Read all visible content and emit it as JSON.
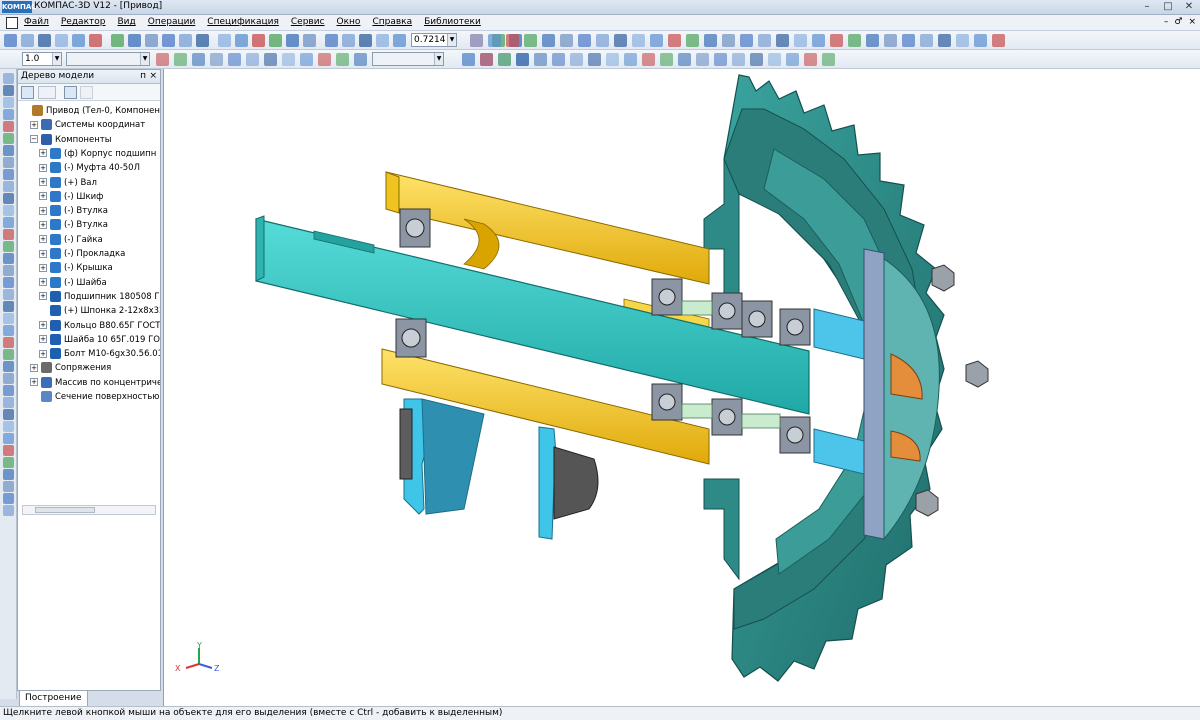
{
  "window": {
    "logo": "KOMПАС",
    "title": "КОМПАС-3D V12 - [Привод]",
    "controls": [
      "–",
      "□",
      "✕"
    ]
  },
  "menu": {
    "app_icon": "document-icon",
    "items": [
      "Файл",
      "Редактор",
      "Вид",
      "Операции",
      "Спецификация",
      "Сервис",
      "Окно",
      "Справка",
      "Библиотеки"
    ],
    "mdi_controls": [
      "–",
      "♂",
      "×"
    ]
  },
  "toolbar": {
    "zoom_value": "0.7214",
    "step_value": "1.0"
  },
  "tree": {
    "title": "Дерево модели",
    "pin": "п",
    "close": "×",
    "tab_label": "Построение",
    "items": [
      {
        "label": "Привод (Тел-0, Компонентов",
        "icon": "assembly-icon",
        "indent": 0,
        "expander": ""
      },
      {
        "label": "Системы координат",
        "icon": "coordinate-system-icon",
        "indent": 1,
        "expander": "+"
      },
      {
        "label": "Компоненты",
        "icon": "components-icon",
        "indent": 1,
        "expander": "−"
      },
      {
        "label": "(ф) Корпус подшипн",
        "icon": "part-icon",
        "indent": 2,
        "expander": "+"
      },
      {
        "label": "(-) Муфта 40-50Л",
        "icon": "part-icon",
        "indent": 2,
        "expander": "+"
      },
      {
        "label": "(+) Вал",
        "icon": "part-icon",
        "indent": 2,
        "expander": "+"
      },
      {
        "label": "(-) Шкиф",
        "icon": "part-icon",
        "indent": 2,
        "expander": "+"
      },
      {
        "label": "(-) Втулка",
        "icon": "part-icon",
        "indent": 2,
        "expander": "+"
      },
      {
        "label": "(-) Втулка",
        "icon": "part-icon",
        "indent": 2,
        "expander": "+"
      },
      {
        "label": "(-) Гайка",
        "icon": "part-icon",
        "indent": 2,
        "expander": "+"
      },
      {
        "label": "(-) Прокладка",
        "icon": "part-icon",
        "indent": 2,
        "expander": "+"
      },
      {
        "label": "(-) Крышка",
        "icon": "part-icon",
        "indent": 2,
        "expander": "+"
      },
      {
        "label": "(-) Шайба",
        "icon": "part-icon",
        "indent": 2,
        "expander": "+"
      },
      {
        "label": "Подшипник 180508 Г",
        "icon": "standard-part-icon",
        "indent": 2,
        "expander": "+"
      },
      {
        "label": "(+) Шпонка 2-12х8х32",
        "icon": "standard-part-icon",
        "indent": 2,
        "expander": ""
      },
      {
        "label": "Кольцо В80.65Г ГОСТ",
        "icon": "standard-part-icon",
        "indent": 2,
        "expander": "+"
      },
      {
        "label": "Шайба 10 65Г.019 ГО",
        "icon": "standard-part-icon",
        "indent": 2,
        "expander": "+"
      },
      {
        "label": "Болт М10-6gx30.56.01",
        "icon": "standard-part-icon",
        "indent": 2,
        "expander": "+"
      },
      {
        "label": "Сопряжения",
        "icon": "mates-icon",
        "indent": 1,
        "expander": "+"
      },
      {
        "label": "Массив по концентриче",
        "icon": "circular-array-icon",
        "indent": 1,
        "expander": "+"
      },
      {
        "label": "Сечение поверхностью:",
        "icon": "section-icon",
        "indent": 1,
        "expander": ""
      }
    ]
  },
  "viewport": {
    "axes": {
      "x": "X",
      "y": "Y",
      "z": "Z"
    },
    "colors": {
      "shaft": "#34c7c4",
      "housing": "#f5cc1c",
      "pulley": "#2e8a86",
      "coupling": "#4dc5ea",
      "bearing": "#8c95a3",
      "spacer": "#c9eccf",
      "nut_orange": "#e48d3b"
    }
  },
  "status": {
    "text": "Щелкните левой кнопкой мыши на объекте для его выделения (вместе с Ctrl - добавить к выделенным)"
  }
}
